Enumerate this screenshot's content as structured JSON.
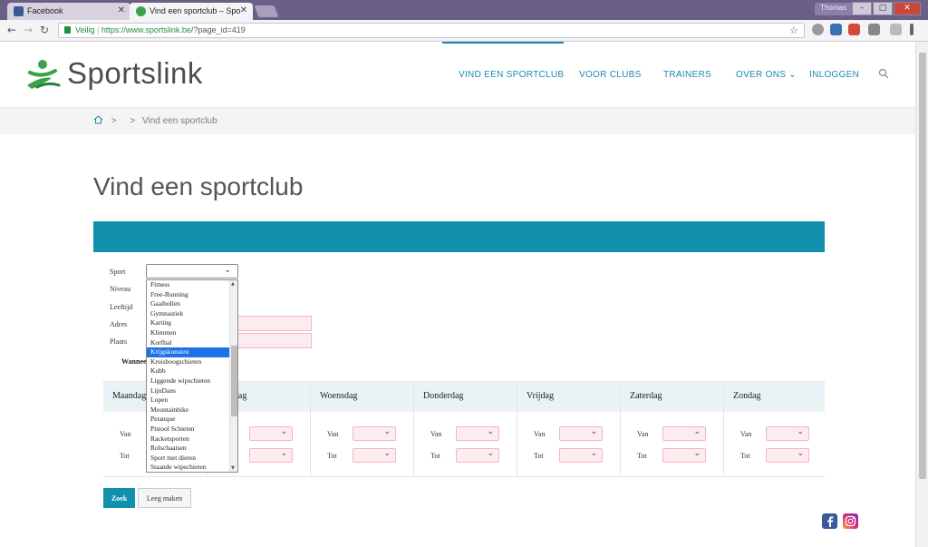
{
  "browser": {
    "tabs": [
      {
        "title": "Facebook",
        "favicon_color": "#3b5998"
      },
      {
        "title": "Vind een sportclub – Spo",
        "favicon_color": "#3aa34a"
      }
    ],
    "user": "Thomas",
    "window_controls": {
      "minimize": "–",
      "maximize": "□",
      "close": "✕"
    },
    "secure_label": "Veilig",
    "url_scheme_host": "https://www.sportslink.be",
    "url_path": "/?page_id=419"
  },
  "site": {
    "logo_text": "Sportslink",
    "brand_color": "#1190ae",
    "nav": [
      {
        "label": "VIND EEN SPORTCLUB"
      },
      {
        "label": "VOOR CLUBS"
      },
      {
        "label": "TRAINERS"
      },
      {
        "label": "OVER ONS ⌄"
      },
      {
        "label": "INLOGGEN"
      }
    ],
    "breadcrumb": {
      "separator_1": ">",
      "separator_2": ">",
      "current": "Vind een sportclub"
    }
  },
  "page": {
    "title": "Vind een sportclub"
  },
  "form": {
    "labels": {
      "sport": "Sport",
      "niveau": "Niveau",
      "leeftijd": "Leeftijd",
      "adres": "Adres",
      "plaats": "Plaats",
      "wanneer": "Wanneer"
    },
    "sport_options": [
      "Fitness",
      "Free-Running",
      "Gaaibollen",
      "Gymnastiek",
      "Karting",
      "Klimmen",
      "Korfbal",
      "Krijgskunsten",
      "Kruisboogschieten",
      "Kubb",
      "Liggende wipschieten",
      "LijnDans",
      "Lopen",
      "Mountainbike",
      "Petanque",
      "Pistool Schieten",
      "Racketsporten",
      "Rolschaatsen",
      "Sport met dieren",
      "Staande wipschieten"
    ],
    "highlighted_option": "Krijgskunsten",
    "days": [
      {
        "name": "Maandag"
      },
      {
        "name": "Dinsdag"
      },
      {
        "name": "Woensdag"
      },
      {
        "name": "Donderdag"
      },
      {
        "name": "Vrijdag"
      },
      {
        "name": "Zaterdag"
      },
      {
        "name": "Zondag"
      }
    ],
    "van_label": "Van",
    "tot_label": "Tot",
    "buttons": {
      "search": "Zoek",
      "clear": "Leeg maken"
    }
  },
  "icons": {
    "home": "home-icon",
    "search": "search-icon",
    "facebook": "facebook-icon",
    "instagram": "instagram-icon"
  }
}
